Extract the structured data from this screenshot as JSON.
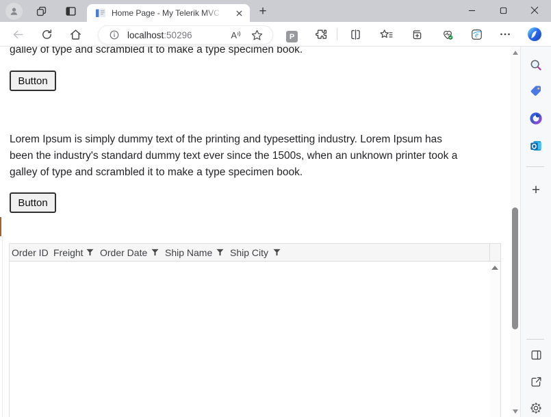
{
  "browser": {
    "tab_title": "Home Page - My Telerik MVC Ap",
    "address": {
      "host": "localhost",
      "port": ":50296"
    },
    "glyphs": {
      "new_tab": "+",
      "read_aloud_letter": "A",
      "extension_badge": "P",
      "ie_mode_letter": "e",
      "sidebar_add": "+"
    }
  },
  "page": {
    "clipped_line": "galley of type and scrambled it to make a type specimen book.",
    "buttons": {
      "top": "Button",
      "bottom": "Button"
    },
    "paragraph_lines": [
      "Lorem Ipsum is simply dummy text of the printing and typesetting industry. Lorem Ipsum has",
      "been the industry's standard dummy text ever since the 1500s, when an unknown printer took a",
      "galley of type and scrambled it to make a type specimen book."
    ],
    "grid": {
      "columns": [
        {
          "label": "Order ID",
          "filterable": false
        },
        {
          "label": "Freight",
          "filterable": true
        },
        {
          "label": "Order Date",
          "filterable": true
        },
        {
          "label": "Ship Name",
          "filterable": true
        },
        {
          "label": "Ship City",
          "filterable": true
        }
      ],
      "rows": []
    }
  },
  "colors": {
    "tabstrip_bg": "#cbcdd2",
    "scrollbar_thumb": "#8d8d8f",
    "left_edge_marker": "#a5622e",
    "grid_header_bg": "#f6f6f6",
    "copilot_accent": "#2a6bf2"
  }
}
